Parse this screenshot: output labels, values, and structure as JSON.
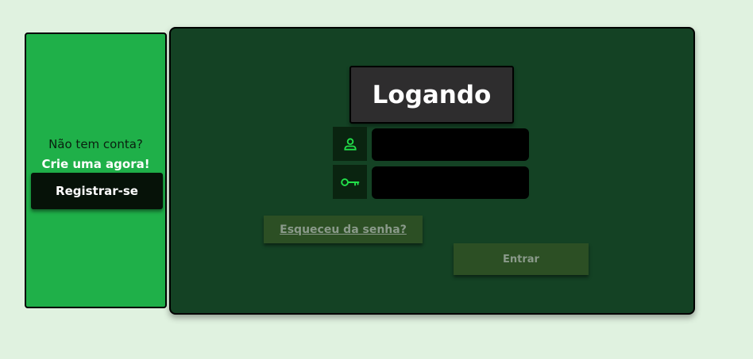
{
  "signup": {
    "prompt": "Não tem conta?",
    "cta": "Crie uma agora!",
    "register_label": "Registrar-se"
  },
  "login": {
    "title": "Logando",
    "username_icon": "user-icon",
    "username_value": "",
    "password_icon": "key-icon",
    "password_value": "",
    "forgot_label": "Esqueceu da senha?",
    "enter_label": "Entrar"
  },
  "colors": {
    "page_background": "#e0f2e0",
    "signup_panel": "#1fb049",
    "login_panel": "#144224",
    "accent_icon": "#22e04a",
    "title_box": "#2e2d2e",
    "disabled_button": "#2c4f24"
  }
}
